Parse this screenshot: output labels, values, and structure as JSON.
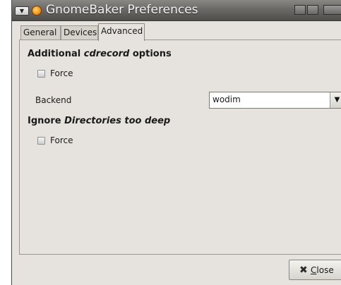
{
  "window": {
    "title": "GnomeBaker Preferences"
  },
  "tabs": [
    {
      "label": "General",
      "active": false
    },
    {
      "label": "Devices",
      "active": false
    },
    {
      "label": "Advanced",
      "active": true
    }
  ],
  "advanced": {
    "section1": {
      "prefix": "Additional ",
      "emphasis": "cdrecord",
      "suffix": " options"
    },
    "force1": {
      "label": "Force",
      "checked": false
    },
    "backend": {
      "label": "Backend",
      "value": "wodim"
    },
    "section2": {
      "prefix": "Ignore ",
      "emphasis": "Directories too deep"
    },
    "force2": {
      "label": "Force",
      "checked": false
    }
  },
  "footer": {
    "close_mnemonic": "C",
    "close_rest": "lose"
  },
  "icons": {
    "menu": "window-menu-icon",
    "app": "gnomebaker-icon",
    "close_button": "close-x-icon",
    "combo": "dropdown-arrow-icon"
  }
}
